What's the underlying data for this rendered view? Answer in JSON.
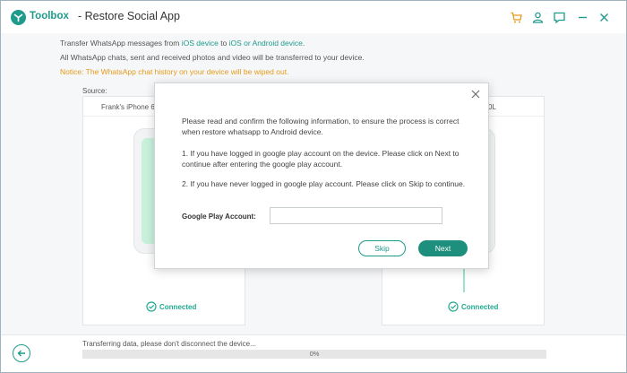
{
  "app": {
    "brand": "Toolbox",
    "title": "- Restore Social App",
    "accent_color": "#1f9b8b"
  },
  "titlebar_icons": [
    "cart-icon",
    "user-icon",
    "feedback-icon",
    "minimize-icon",
    "close-icon"
  ],
  "intro": {
    "line1_prefix": "Transfer WhatsApp messages from ",
    "line1_from": "iOS device",
    "line1_mid": " to ",
    "line1_to": "iOS or Android device",
    "line1_suffix": ".",
    "line2": "All WhatsApp chats, sent and received photos and video will be transferred to your device.",
    "notice": "Notice: The WhatsApp chat history on your device will be wiped out."
  },
  "source": {
    "label": "Source:",
    "device_name": "Frank's iPhone 6",
    "status": "Connected"
  },
  "destination": {
    "device_name": "0L",
    "status": "Connected"
  },
  "bottom": {
    "status_text": "Transferring data, please don't disconnect the device...",
    "progress_percent": 0,
    "progress_label": "0%"
  },
  "dialog": {
    "paragraph1": "Please read and confirm the following information, to ensure the process is correct when restore whatsapp to Android device.",
    "paragraph2": "1. If you have logged in google play account on the device. Please click on Next to continue after entering the google play account.",
    "paragraph3": "2. If you have never logged in google play account. Please click on Skip to continue.",
    "account_label": "Google Play Account:",
    "account_value": "",
    "account_placeholder": "",
    "skip_label": "Skip",
    "next_label": "Next"
  }
}
